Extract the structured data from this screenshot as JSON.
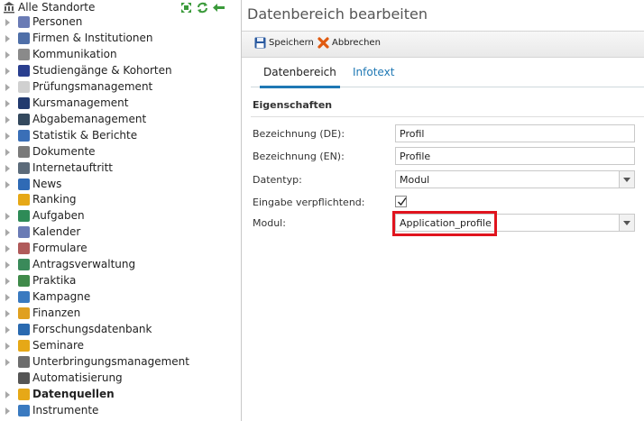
{
  "tree": {
    "root_label": "Alle Standorte",
    "items": [
      {
        "label": "Personen",
        "icon": "users-icon",
        "color": "#6a7bb5",
        "expandable": true
      },
      {
        "label": "Firmen & Institutionen",
        "icon": "factory-icon",
        "color": "#4f6fa8",
        "expandable": true
      },
      {
        "label": "Kommunikation",
        "icon": "envelope-icon",
        "color": "#8a8a8a",
        "expandable": true
      },
      {
        "label": "Studiengänge & Kohorten",
        "icon": "feather-icon",
        "color": "#2a3f8f",
        "expandable": true
      },
      {
        "label": "Prüfungsmanagement",
        "icon": "document-icon",
        "color": "#d0d0d0",
        "expandable": true
      },
      {
        "label": "Kursmanagement",
        "icon": "book-icon",
        "color": "#223a6e",
        "expandable": true
      },
      {
        "label": "Abgabemanagement",
        "icon": "contact-card-icon",
        "color": "#34495e",
        "expandable": true
      },
      {
        "label": "Statistik & Berichte",
        "icon": "bar-chart-icon",
        "color": "#3a6fb7",
        "expandable": true
      },
      {
        "label": "Dokumente",
        "icon": "folder-icon",
        "color": "#7a7a7a",
        "expandable": true
      },
      {
        "label": "Internetauftritt",
        "icon": "globe-icon",
        "color": "#5c6b7a",
        "expandable": true
      },
      {
        "label": "News",
        "icon": "info-icon",
        "color": "#2f6ab5",
        "expandable": true
      },
      {
        "label": "Ranking",
        "icon": "star-icon",
        "color": "#e6a817",
        "expandable": false
      },
      {
        "label": "Aufgaben",
        "icon": "clock-check-icon",
        "color": "#2e8b57",
        "expandable": true
      },
      {
        "label": "Kalender",
        "icon": "calendar-icon",
        "color": "#6a7bb5",
        "expandable": true
      },
      {
        "label": "Formulare",
        "icon": "form-icon",
        "color": "#b05a5a",
        "expandable": true
      },
      {
        "label": "Antragsverwaltung",
        "icon": "application-icon",
        "color": "#3a8a5a",
        "expandable": true
      },
      {
        "label": "Praktika",
        "icon": "building-icon",
        "color": "#3f8a4a",
        "expandable": true
      },
      {
        "label": "Kampagne",
        "icon": "puzzle-icon",
        "color": "#3a7ac0",
        "expandable": true
      },
      {
        "label": "Finanzen",
        "icon": "coins-icon",
        "color": "#e0a020",
        "expandable": true
      },
      {
        "label": "Forschungsdatenbank",
        "icon": "line-chart-icon",
        "color": "#2a6ab0",
        "expandable": true
      },
      {
        "label": "Seminare",
        "icon": "briefcase-icon",
        "color": "#e6a817",
        "expandable": true
      },
      {
        "label": "Unterbringungsmanagement",
        "icon": "apartment-icon",
        "color": "#6d6d6d",
        "expandable": true
      },
      {
        "label": "Automatisierung",
        "icon": "gear-icon",
        "color": "#555555",
        "expandable": false
      },
      {
        "label": "Datenquellen",
        "icon": "database-icon",
        "color": "#e6a817",
        "expandable": true,
        "bold": true
      },
      {
        "label": "Instrumente",
        "icon": "instrument-icon",
        "color": "#3a7ac0",
        "expandable": true
      }
    ]
  },
  "panel": {
    "title": "Datenbereich bearbeiten",
    "toolbar": {
      "save_label": "Speichern",
      "cancel_label": "Abbrechen"
    },
    "tabs": [
      {
        "label": "Datenbereich",
        "active": true
      },
      {
        "label": "Infotext",
        "active": false
      }
    ],
    "section_title": "Eigenschaften",
    "fields": {
      "name_de": {
        "label": "Bezeichnung (DE):",
        "value": "Profil"
      },
      "name_en": {
        "label": "Bezeichnung (EN):",
        "value": "Profile"
      },
      "datatype": {
        "label": "Datentyp:",
        "value": "Modul"
      },
      "required": {
        "label": "Eingabe verpflichtend:",
        "checked": true
      },
      "module": {
        "label": "Modul:",
        "value": "Application_profile"
      }
    }
  },
  "colors": {
    "accent": "#1f78b4",
    "highlight": "#e0141e"
  }
}
